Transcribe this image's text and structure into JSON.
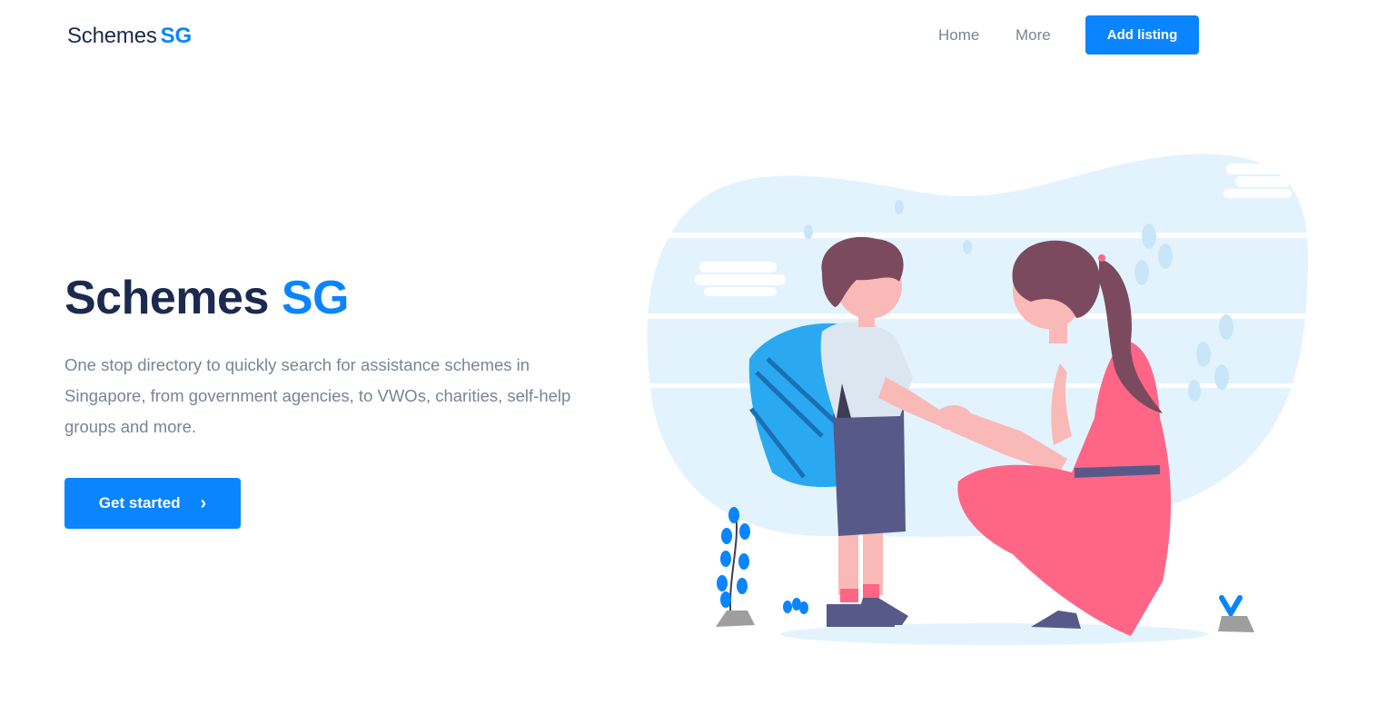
{
  "nav": {
    "brand_main": "Schemes",
    "brand_accent": "SG",
    "links": [
      {
        "label": "Home"
      },
      {
        "label": "More"
      }
    ],
    "cta_label": "Add listing"
  },
  "hero": {
    "title_main": "Schemes",
    "title_accent": "SG",
    "description": "One stop directory to quickly search for assistance schemes in Singapore, from government agencies, to VWOs, charities, self-help groups and more.",
    "cta_label": "Get started",
    "cta_icon": "chevron-right-icon"
  },
  "illustration": {
    "name": "parent-child-illustration"
  },
  "colors": {
    "accent": "#0a84ff",
    "heading": "#1b2a4e",
    "muted": "#7a8494"
  }
}
